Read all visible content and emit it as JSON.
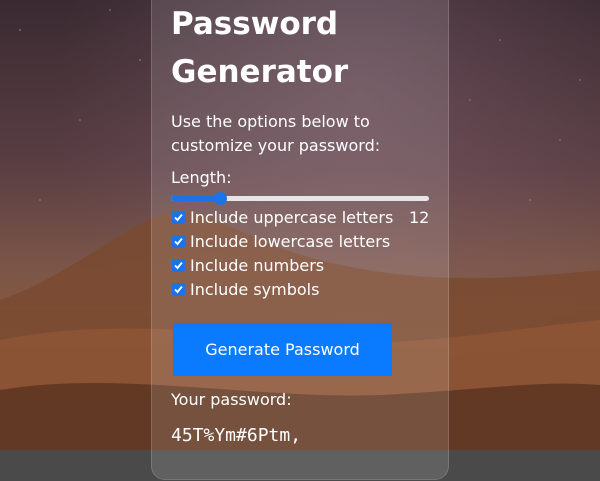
{
  "app": {
    "title": "Password Generator",
    "description": "Use the options below to customize your password:"
  },
  "length": {
    "label": "Length:",
    "value": "12",
    "slider_fraction": 0.19
  },
  "options": [
    {
      "label": "Include uppercase letters",
      "checked": true
    },
    {
      "label": "Include lowercase letters",
      "checked": true
    },
    {
      "label": "Include numbers",
      "checked": true
    },
    {
      "label": "Include symbols",
      "checked": true
    }
  ],
  "button": {
    "label": "Generate Password"
  },
  "result": {
    "label": "Your password:",
    "password": "45T%Ym#6Ptm,"
  },
  "colors": {
    "accent": "#1a73e8",
    "button": "#0a7bff"
  }
}
